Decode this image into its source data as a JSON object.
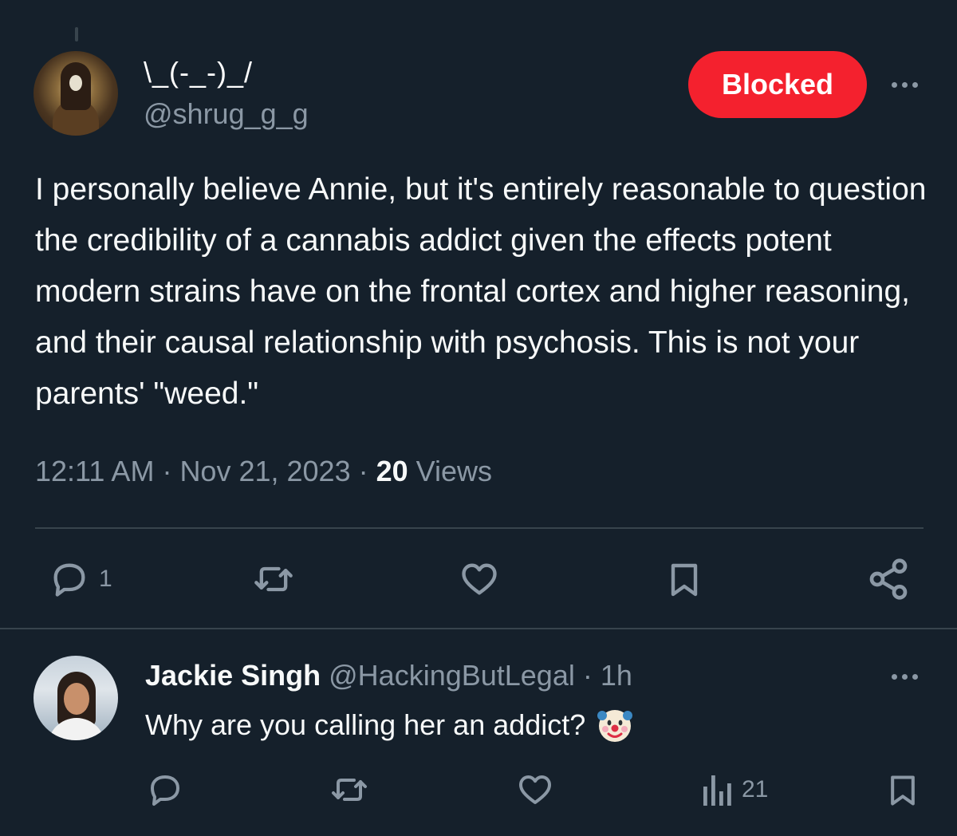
{
  "tweet": {
    "display_name": "\\_(-_-)_/",
    "handle": "@shrug_g_g",
    "follow_state": "Blocked",
    "text": "I personally believe Annie, but it's entirely reasonable to question the credibility of a cannabis addict given the effects potent modern strains have on the frontal cortex and higher reasoning, and their causal relationship with psychosis. This is not your parents' \"weed.\"",
    "time": "12:11 AM",
    "separator": " · ",
    "date": "Nov 21, 2023",
    "views_count": "20",
    "views_label": " Views",
    "reply_count": "1"
  },
  "reply": {
    "display_name": "Jackie Singh",
    "handle": "@HackingButLegal",
    "separator": " · ",
    "age": "1h",
    "text": "Why are you calling her an addict?",
    "emoji_icon": "clown-face-icon",
    "views_count": "21"
  },
  "colors": {
    "background": "#15202b",
    "blocked": "#f4212e",
    "secondary_text": "#8b98a5",
    "divider": "#38444d"
  }
}
